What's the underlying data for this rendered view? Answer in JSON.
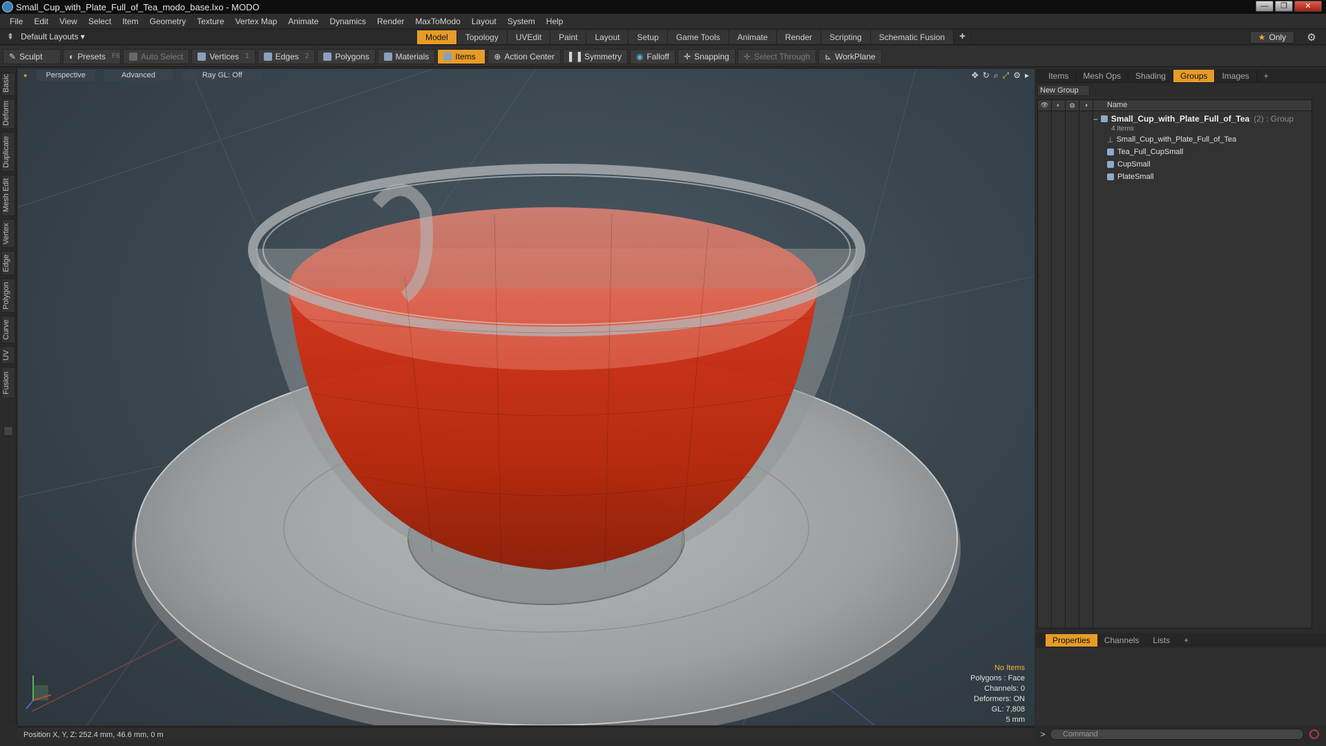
{
  "window": {
    "title": "Small_Cup_with_Plate_Full_of_Tea_modo_base.lxo - MODO",
    "controls": [
      "—",
      "❐",
      "✕"
    ]
  },
  "menu": [
    "File",
    "Edit",
    "View",
    "Select",
    "Item",
    "Geometry",
    "Texture",
    "Vertex Map",
    "Animate",
    "Dynamics",
    "Render",
    "MaxToModo",
    "Layout",
    "System",
    "Help"
  ],
  "layouts": {
    "default": "Default Layouts ▾",
    "tabs": [
      "Model",
      "Topology",
      "UVEdit",
      "Paint",
      "Layout",
      "Setup",
      "Game Tools",
      "Animate",
      "Render",
      "Scripting",
      "Schematic Fusion"
    ],
    "active_tab": "Model",
    "plus": "+",
    "only": "Only"
  },
  "toolbar": {
    "sculpt": "Sculpt",
    "presets": "Presets",
    "presets_key": "F6",
    "auto_select": "Auto Select",
    "vertices": "Vertices",
    "vertices_key": "1",
    "edges": "Edges",
    "edges_key": "2",
    "polygons": "Polygons",
    "materials": "Materials",
    "items": "Items",
    "action_center": "Action Center",
    "symmetry": "Symmetry",
    "falloff": "Falloff",
    "snapping": "Snapping",
    "select_through": "Select Through",
    "workplane": "WorkPlane"
  },
  "left_tabs": [
    "Basic",
    "Deform",
    "Duplicate",
    "Mesh Edit",
    "Vertex",
    "Edge",
    "Polygon",
    "Curve",
    "UV",
    "Fusion"
  ],
  "viewport": {
    "view": "Perspective",
    "shading": "Advanced",
    "raygl": "Ray GL: Off",
    "info": [
      "No Items",
      "Polygons : Face",
      "Channels: 0",
      "Deformers: ON",
      "GL: 7,808",
      "5 mm"
    ]
  },
  "status": {
    "position": "Position X, Y, Z:  252.4 mm, 46.6 mm, 0 m"
  },
  "right_panel": {
    "tabs": [
      "Items",
      "Mesh Ops",
      "Shading",
      "Groups",
      "Images"
    ],
    "active_tab": "Groups",
    "new_group": "New Group",
    "name_header": "Name",
    "group_name": "Small_Cup_with_Plate_Full_of_Tea",
    "group_count": "(2) : Group",
    "group_items": "4 Items",
    "children": [
      "Small_Cup_with_Plate_Full_of_Tea",
      "Tea_Full_CupSmall",
      "CupSmall",
      "PlateSmall"
    ]
  },
  "props": {
    "tabs": [
      "Properties",
      "Channels",
      "Lists"
    ],
    "active_tab": "Properties"
  },
  "command": {
    "placeholder": "Command"
  },
  "colors": {
    "accent": "#e79c27",
    "tea": "#c02a05",
    "porcelain": "#9a9a9a"
  }
}
